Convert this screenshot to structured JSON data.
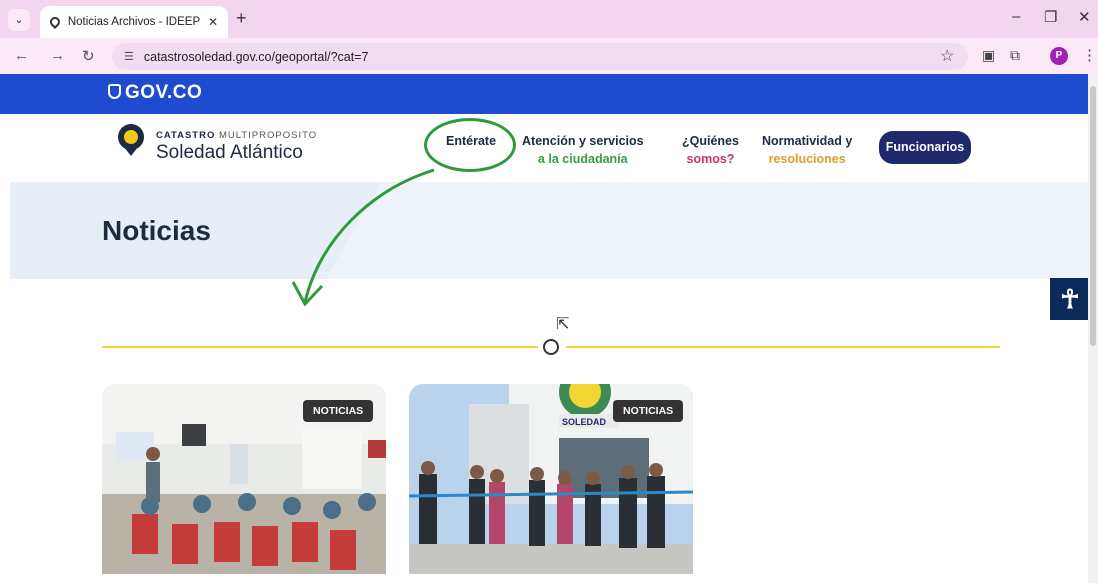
{
  "browser": {
    "tab_title": "Noticias Archivos - IDEEP Soled",
    "url": "catastrosoledad.gov.co/geoportal/?cat=7",
    "profile_initial": "P"
  },
  "gov_bar": {
    "label": "GOV.CO"
  },
  "header": {
    "brand_strong": "CATASTRO",
    "brand_light": " MULTIPROPOSITO",
    "brand_name": "Soledad Atlántico",
    "menu": [
      {
        "line1": "Entérate",
        "line2": ""
      },
      {
        "line1": "Atención y servicios",
        "line2": "a la ciudadanía"
      },
      {
        "line1": "¿Quiénes",
        "line2": "somos?"
      },
      {
        "line1": "Normatividad y",
        "line2": "resoluciones"
      }
    ],
    "cta_label": "Funcionarios"
  },
  "hero": {
    "title": "Noticias"
  },
  "cards": [
    {
      "badge": "NOTICIAS",
      "image": "news-meeting-photo"
    },
    {
      "badge": "NOTICIAS",
      "image": "ribbon-cutting-photo"
    }
  ],
  "colors": {
    "gov_blue": "#1f4bd0",
    "navy": "#1e2a44",
    "accent_yellow": "#f2d635",
    "annotation_green": "#2e9a3c"
  }
}
